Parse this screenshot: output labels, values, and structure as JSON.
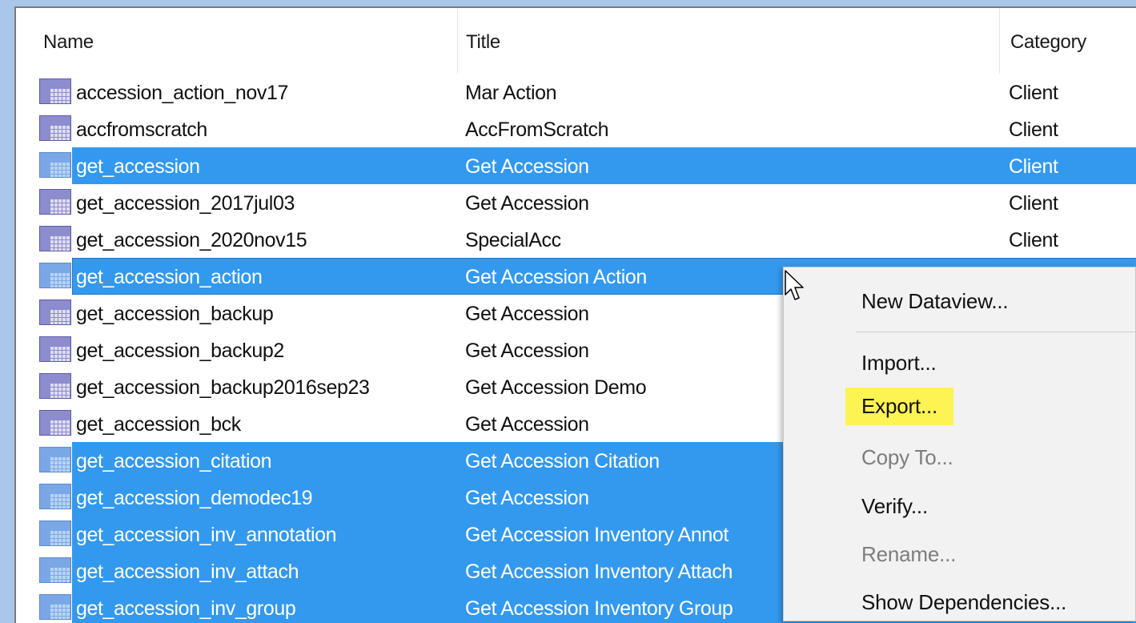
{
  "columns": {
    "name": "Name",
    "title": "Title",
    "category": "Category"
  },
  "rows": [
    {
      "name": "accession_action_nov17",
      "title": "Mar Action",
      "category": "Client",
      "selected": false
    },
    {
      "name": "accfromscratch",
      "title": "AccFromScratch",
      "category": "Client",
      "selected": false
    },
    {
      "name": "get_accession",
      "title": "Get Accession",
      "category": "Client",
      "selected": true
    },
    {
      "name": "get_accession_2017jul03",
      "title": "Get Accession",
      "category": "Client",
      "selected": false
    },
    {
      "name": "get_accession_2020nov15",
      "title": "SpecialAcc",
      "category": "Client",
      "selected": false
    },
    {
      "name": "get_accession_action",
      "title": "Get Accession Action",
      "category": "Client",
      "selected": true
    },
    {
      "name": "get_accession_backup",
      "title": "Get Accession",
      "category": "",
      "selected": false
    },
    {
      "name": "get_accession_backup2",
      "title": "Get Accession",
      "category": "",
      "selected": false
    },
    {
      "name": "get_accession_backup2016sep23",
      "title": "Get Accession Demo",
      "category": "",
      "selected": false
    },
    {
      "name": "get_accession_bck",
      "title": "Get Accession",
      "category": "",
      "selected": false
    },
    {
      "name": "get_accession_citation",
      "title": "Get Accession Citation",
      "category": "",
      "selected": true
    },
    {
      "name": "get_accession_demodec19",
      "title": "Get Accession",
      "category": "",
      "selected": true
    },
    {
      "name": "get_accession_inv_annotation",
      "title": "Get Accession Inventory Annot",
      "category": "",
      "selected": true
    },
    {
      "name": "get_accession_inv_attach",
      "title": "Get Accession Inventory Attach",
      "category": "",
      "selected": true
    },
    {
      "name": "get_accession_inv_group",
      "title": "Get Accession Inventory Group",
      "category": "",
      "selected": true
    }
  ],
  "context_menu": {
    "new_dataview": "New Dataview...",
    "import": "Import...",
    "export": "Export...",
    "copy_to": "Copy To...",
    "verify": "Verify...",
    "rename": "Rename...",
    "show_dependencies": "Show Dependencies..."
  },
  "colors": {
    "selection": "#3399ee",
    "highlight": "#fdf352",
    "icon": "table-icon"
  }
}
